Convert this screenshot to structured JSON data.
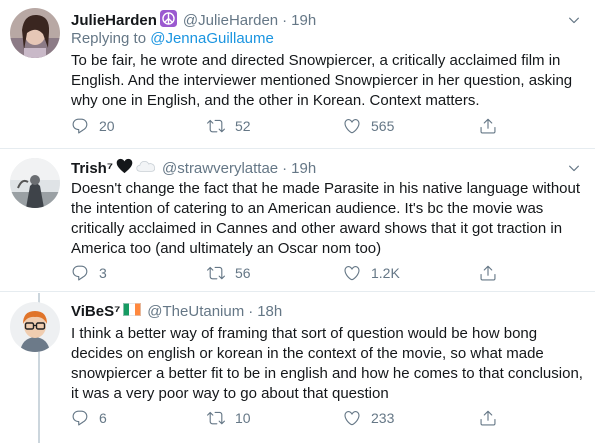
{
  "tweets": [
    {
      "name": "JulieHarden",
      "handle": "@JulieHarden",
      "time": "19h",
      "replying_prefix": "Replying to ",
      "replying_to": "@JennaGuillaume",
      "text": "To be fair, he wrote and directed Snowpiercer, a critically acclaimed film in English.  And the interviewer mentioned Snowpiercer in her question, asking why one in English, and the other in Korean.  Context matters.",
      "replies": "20",
      "retweets": "52",
      "likes": "565",
      "badge_icon": "peace-sign-icon"
    },
    {
      "name": "Trish⁷",
      "handle": "@strawverylattae",
      "time": "19h",
      "text": "Doesn't change the fact that he made Parasite in his native language without the intention of catering to an American audience. It's bc the movie was critically acclaimed in Cannes and other award shows that it got traction in America too (and ultimately an Oscar nom too)",
      "replies": "3",
      "retweets": "56",
      "likes": "1.2K",
      "badge_icons": [
        "black-heart-icon",
        "cloud-icon"
      ]
    },
    {
      "name": "ViBeS⁷",
      "handle": "@TheUtanium",
      "time": "18h",
      "text": "I think a better way of framing that sort of question would be how bong decides on english or korean in the context of the movie, so what made snowpiercer a better fit to be in english and how he comes to that conclusion, it was a very poor way to go about that question",
      "replies": "6",
      "retweets": "10",
      "likes": "233",
      "badge_icon": "ireland-flag-icon"
    }
  ],
  "dot": "·",
  "colors": {
    "link": "#1b95e0",
    "secondary": "#657786",
    "divider": "#e6ecf0",
    "peace_badge": "#9b59d0"
  }
}
